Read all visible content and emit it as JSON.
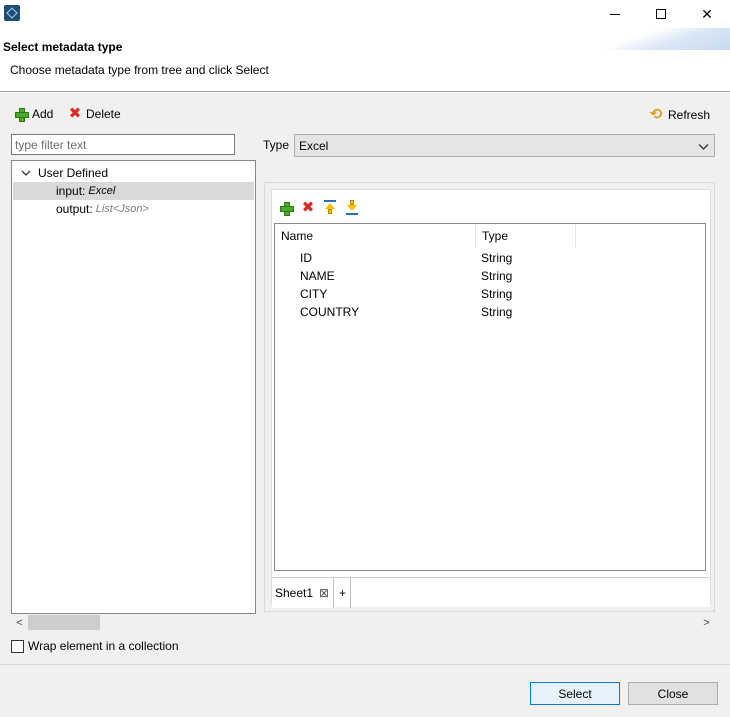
{
  "window": {
    "minimize": "",
    "maximize": "",
    "close": "✕"
  },
  "header": {
    "title": "Select metadata type",
    "description": "Choose metadata type from tree and click Select"
  },
  "toolbar": {
    "add_label": "Add",
    "delete_label": "Delete",
    "refresh_label": "Refresh"
  },
  "filter": {
    "placeholder": "type filter text",
    "value": ""
  },
  "tree": {
    "root_label": "User Defined",
    "items": [
      {
        "name": "input",
        "sep": " :",
        "type": "Excel",
        "selected": true
      },
      {
        "name": "output",
        "sep": " :",
        "type": "List<Json>",
        "selected": false
      }
    ]
  },
  "type_selector": {
    "label": "Type",
    "value": "Excel"
  },
  "table": {
    "columns": [
      "Name",
      "Type"
    ],
    "rows": [
      {
        "name": "ID",
        "type": "String"
      },
      {
        "name": "NAME",
        "type": "String"
      },
      {
        "name": "CITY",
        "type": "String"
      },
      {
        "name": "COUNTRY",
        "type": "String"
      }
    ]
  },
  "sheets": {
    "tabs": [
      {
        "label": "Sheet1"
      }
    ],
    "add_label": "+",
    "close_glyph": "⊠"
  },
  "scroll": {
    "left_arrow": "<",
    "right_arrow": ">"
  },
  "options": {
    "wrap_label": "Wrap element in a collection",
    "wrap_checked": false
  },
  "footer": {
    "select_label": "Select",
    "close_label": "Close"
  },
  "colors": {
    "accent": "#0078d7",
    "add_green": "#4caa2a",
    "delete_red": "#d62b22",
    "selection_grey": "#d9d9d9"
  }
}
